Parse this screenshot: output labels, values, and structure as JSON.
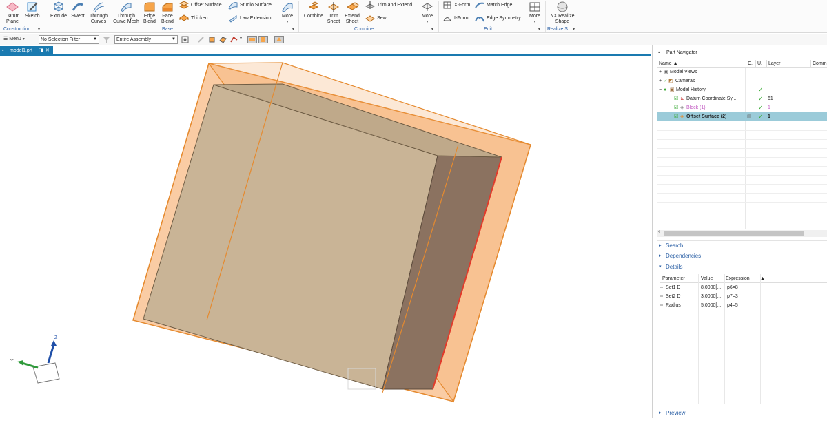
{
  "ribbon": {
    "construction": {
      "datum_plane": "Datum Plane",
      "sketch": "Sketch",
      "group_label": "Construction"
    },
    "base": {
      "extrude": "Extrude",
      "swept": "Swept",
      "through_curves": "Through Curves",
      "through_curve_mesh": "Through Curve Mesh",
      "edge_blend": "Edge Blend",
      "face_blend": "Face Blend",
      "offset_surface": "Offset Surface",
      "thicken": "Thicken",
      "studio_surface": "Studio Surface",
      "law_extension": "Law Extension",
      "more": "More",
      "group_label": "Base"
    },
    "combine": {
      "combine": "Combine",
      "trim_sheet": "Trim Sheet",
      "extend_sheet": "Extend Sheet",
      "trim_and_extend": "Trim and Extend",
      "sew": "Sew",
      "more": "More",
      "group_label": "Combine"
    },
    "edit": {
      "x_form": "X-Form",
      "i_form": "I-Form",
      "match_edge": "Match Edge",
      "edge_symmetry": "Edge Symmetry",
      "more": "More",
      "group_label": "Edit"
    },
    "realize": {
      "nx_realize_shape": "NX Realize Shape",
      "group_label": "Realize S..."
    }
  },
  "toolbar": {
    "menu": "Menu",
    "selection_filter": "No Selection Filter",
    "assembly_scope": "Entire Assembly"
  },
  "tab": {
    "label": "model1.prt"
  },
  "viewport": {
    "axis_z": "Z",
    "axis_y": "Y"
  },
  "navigator": {
    "title": "Part Navigator",
    "columns": {
      "name": "Name",
      "c": "C.",
      "u": "U.",
      "layer": "Layer",
      "comment": "Comm"
    },
    "tree": [
      {
        "label": "Model Views",
        "layer": ""
      },
      {
        "label": "Cameras",
        "layer": ""
      },
      {
        "label": "Model History",
        "layer": ""
      },
      {
        "label": "Datum Coordinate Sy...",
        "layer": "61"
      },
      {
        "label": "Block (1)",
        "layer": "1"
      },
      {
        "label": "Offset Surface (2)",
        "layer": "1"
      }
    ],
    "panels": {
      "search": "Search",
      "dependencies": "Dependencies",
      "details": "Details",
      "preview": "Preview"
    },
    "details": {
      "columns": {
        "parameter": "Parameter",
        "value": "Value",
        "expression": "Expression"
      },
      "rows": [
        {
          "parameter": "Set1 D",
          "value": "8.0000[...",
          "expression": "p6=8"
        },
        {
          "parameter": "Set2 D",
          "value": "3.0000[...",
          "expression": "p7=3"
        },
        {
          "parameter": "Radius",
          "value": "5.0000[...",
          "expression": "p4=5"
        }
      ]
    }
  },
  "colors": {
    "tab_blue": "#1a7ab0",
    "selection": "#9bcbd9",
    "offset_orange": "#f5a35a",
    "block_face": "#c9b496",
    "edge_red": "#e23a2a",
    "check_green": "#3aaa35",
    "link_blue": "#2a5fa5"
  }
}
